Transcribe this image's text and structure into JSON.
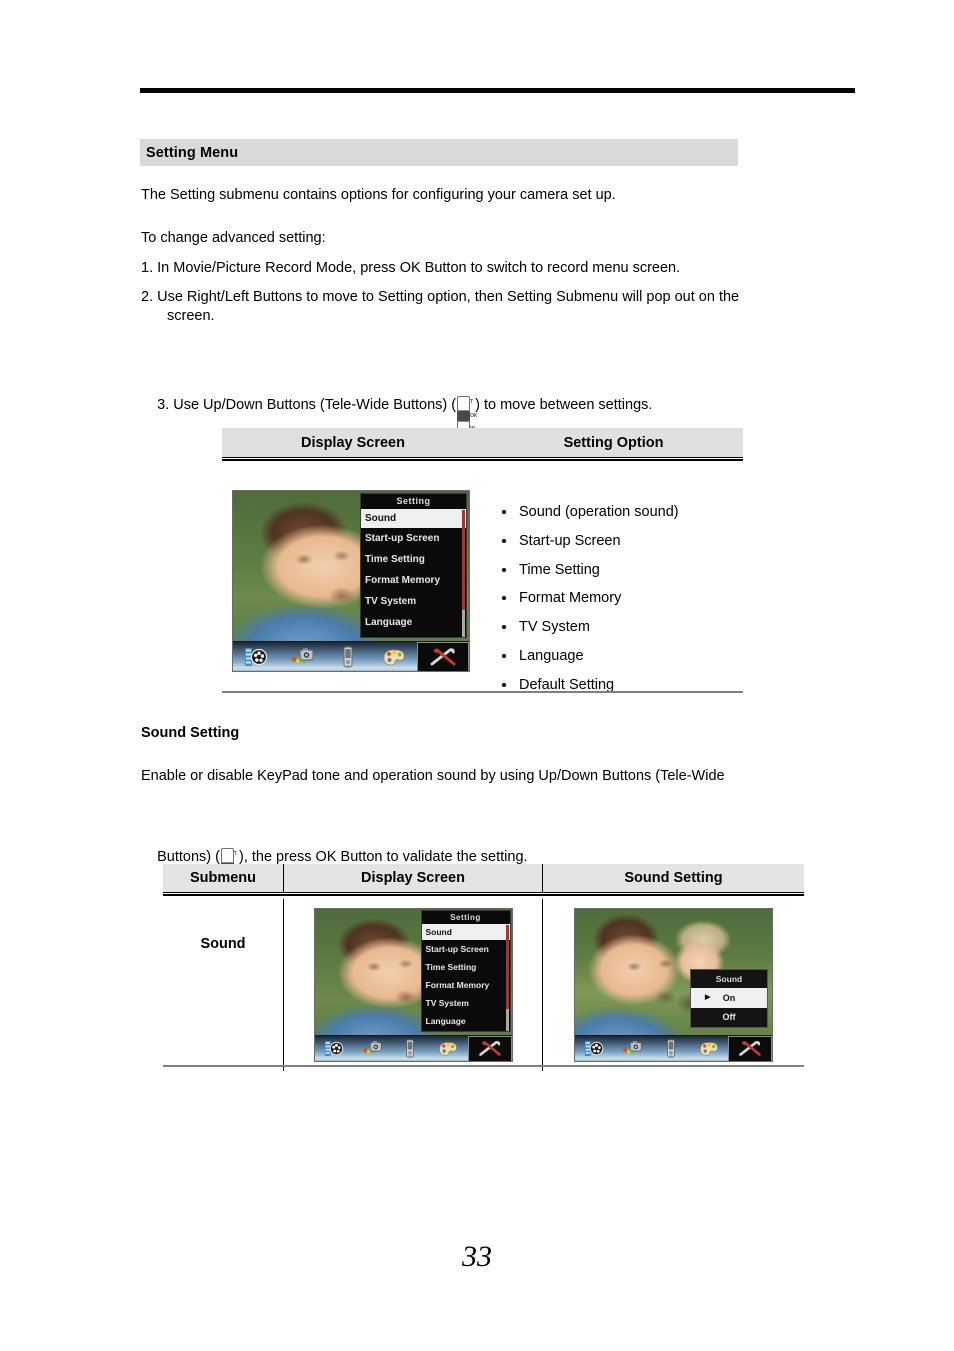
{
  "document": {
    "page_number": "33"
  },
  "section": {
    "heading": "Setting Menu",
    "intro": "The Setting submenu contains options for configuring your camera set up.",
    "to_change": "To change advanced setting:",
    "steps": [
      "1. In Movie/Picture Record Mode, press OK Button to switch to record menu screen.",
      "2. Use Right/Left Buttons to move to Setting option, then Setting Submenu will pop out on the",
      "screen.",
      "3. Use Up/Down Buttons (Tele-Wide Buttons) (",
      ") to move between settings."
    ]
  },
  "rocker_icon": {
    "top_label": "T",
    "mid_label": "OK",
    "bottom_label": "W"
  },
  "table_setting": {
    "headers": [
      "Display Screen",
      "Setting Option"
    ],
    "options": [
      "Sound (operation sound)",
      "Start-up Screen",
      "Time Setting",
      "Format Memory",
      "TV System",
      "Language",
      "Default Setting"
    ]
  },
  "sound_section": {
    "heading": "Sound Setting",
    "line1": "Enable or disable KeyPad tone and operation sound by using Up/Down Buttons (Tele-Wide",
    "line2_pre": "Buttons) (",
    "line2_post": "), the press OK Button to validate the setting."
  },
  "table_sound": {
    "headers": [
      "Submenu",
      "Display Screen",
      "Sound Setting"
    ],
    "row_label": "Sound"
  },
  "lcd_setting_menu": {
    "title": "Setting",
    "items": [
      "Sound",
      "Start-up Screen",
      "Time Setting",
      "Format Memory",
      "TV System",
      "Language"
    ],
    "selected_index": 0
  },
  "lcd_sound_popup": {
    "title": "Sound",
    "options": [
      "On",
      "Off"
    ],
    "selected": "On",
    "arrow_glyph": "▶"
  },
  "lcd_toolbar": {
    "icons": [
      "movie-mode-icon",
      "picture-mode-icon",
      "playback-mode-icon",
      "effect-mode-icon",
      "setting-mode-icon"
    ],
    "active": "setting-mode-icon"
  },
  "colors": {
    "section_bar_bg": "#d9d9d9",
    "table_header_bg": "#e0e0e0",
    "rule": "#000000",
    "table_bottom_rule": "#808080",
    "lcd_selected": "#efefef",
    "scrollbar_thumb": "#b03030"
  }
}
